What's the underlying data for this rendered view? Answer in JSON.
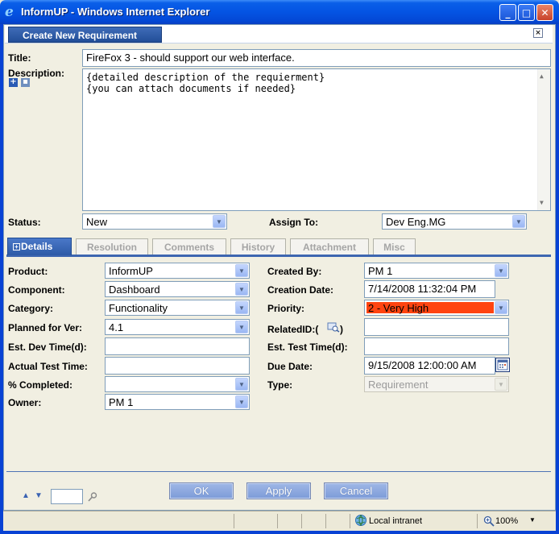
{
  "window": {
    "title": "InformUP - Windows Internet Explorer",
    "minimize_glyph": "_",
    "maximize_glyph": "□",
    "close_glyph": "✕"
  },
  "dialog": {
    "tab_label": "Create New Requirement",
    "close_glyph": "×"
  },
  "form": {
    "title_label": "Title:",
    "title_value": "FireFox 3 - should support our web interface.",
    "description_label": "Description:",
    "description_lines": [
      "{detailed description of the requierment}",
      "{you can attach documents if needed}"
    ],
    "status_label": "Status:",
    "status_value": "New",
    "assign_to_label": "Assign To:",
    "assign_to_value": "Dev Eng.MG"
  },
  "tabs": [
    {
      "label": "Details",
      "active": true
    },
    {
      "label": "Resolution"
    },
    {
      "label": "Comments"
    },
    {
      "label": "History"
    },
    {
      "label": "Attachment"
    },
    {
      "label": "Misc"
    }
  ],
  "details": {
    "product_label": "Product:",
    "product_value": "InformUP",
    "component_label": "Component:",
    "component_value": "Dashboard",
    "category_label": "Category:",
    "category_value": "Functionality",
    "planned_label": "Planned for Ver:",
    "planned_value": "4.1",
    "est_dev_label": "Est. Dev Time(d):",
    "est_dev_value": "",
    "actual_test_label": "Actual Test Time:",
    "actual_test_value": "",
    "completed_label": "% Completed:",
    "completed_value": "",
    "owner_label": "Owner:",
    "owner_value": "PM 1",
    "created_by_label": "Created By:",
    "created_by_value": "PM 1",
    "creation_date_label": "Creation Date:",
    "creation_date_value": "7/14/2008 11:32:04 PM",
    "priority_label": "Priority:",
    "priority_value": "2 - Very High",
    "related_label": "RelatedID:(",
    "related_close": ")",
    "related_value": "",
    "est_test_label": "Est. Test Time(d):",
    "est_test_value": "",
    "due_date_label": "Due Date:",
    "due_date_value": "9/15/2008 12:00:00 AM",
    "type_label": "Type:",
    "type_value": "Requirement"
  },
  "buttons": {
    "ok": "OK",
    "apply": "Apply",
    "cancel": "Cancel"
  },
  "statusbar": {
    "zone": "Local intranet",
    "zoom": "100%"
  },
  "colors": {
    "priority_bg": "#ff4411",
    "accent": "#3d66b0"
  }
}
